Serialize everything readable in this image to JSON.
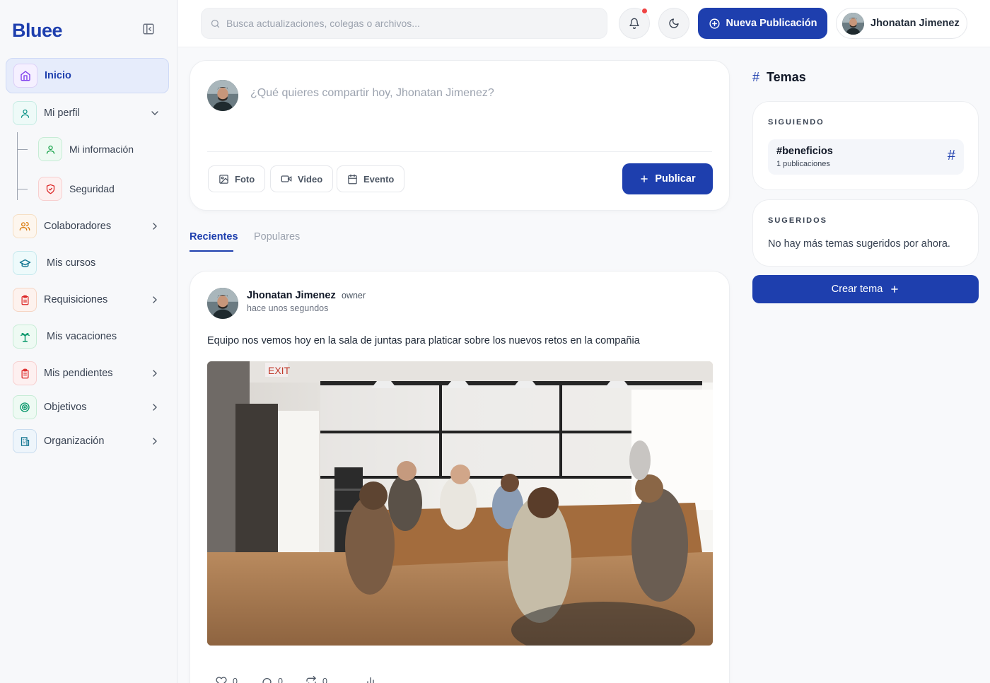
{
  "brand": {
    "name": "Bluee",
    "color": "#1e3fae"
  },
  "sidebar": {
    "items": [
      {
        "label": "Inicio",
        "icon": "home-icon"
      },
      {
        "label": "Mi perfil",
        "icon": "user-icon"
      },
      {
        "label": "Colaboradores",
        "icon": "users-icon"
      },
      {
        "label": "Mis cursos",
        "icon": "graduation-cap-icon"
      },
      {
        "label": "Requisiciones",
        "icon": "clipboard-icon"
      },
      {
        "label": "Mis vacaciones",
        "icon": "palm-tree-icon"
      },
      {
        "label": "Mis pendientes",
        "icon": "clipboard-list-icon"
      },
      {
        "label": "Objetivos",
        "icon": "target-icon"
      },
      {
        "label": "Organización",
        "icon": "building-icon"
      }
    ],
    "subitems": [
      {
        "label": "Mi información",
        "icon": "user-icon"
      },
      {
        "label": "Seguridad",
        "icon": "shield-icon"
      }
    ]
  },
  "topbar": {
    "search_placeholder": "Busca actualizaciones, colegas o archivos...",
    "new_post_label": "Nueva Publicación",
    "user_name": "Jhonatan Jimenez"
  },
  "composer": {
    "prompt": "¿Qué quieres compartir hoy, Jhonatan Jimenez?",
    "photo_label": "Foto",
    "video_label": "Video",
    "event_label": "Evento",
    "publish_label": "Publicar"
  },
  "tabs": {
    "recent": "Recientes",
    "popular": "Populares"
  },
  "post": {
    "author": "Jhonatan Jimenez",
    "role": "owner",
    "time": "hace unos segundos",
    "body": "Equipo nos vemos hoy en la sala de juntas para platicar sobre los nuevos retos en la compañia",
    "likes": "0",
    "comments": "0",
    "reposts": "0"
  },
  "topics": {
    "title": "Temas",
    "following_head": "SIGUIENDO",
    "following": [
      {
        "name": "#beneficios",
        "count": "1 publicaciones"
      }
    ],
    "suggested_head": "SUGERIDOS",
    "suggested_empty": "No hay más temas sugeridos por ahora.",
    "create_label": "Crear tema"
  }
}
